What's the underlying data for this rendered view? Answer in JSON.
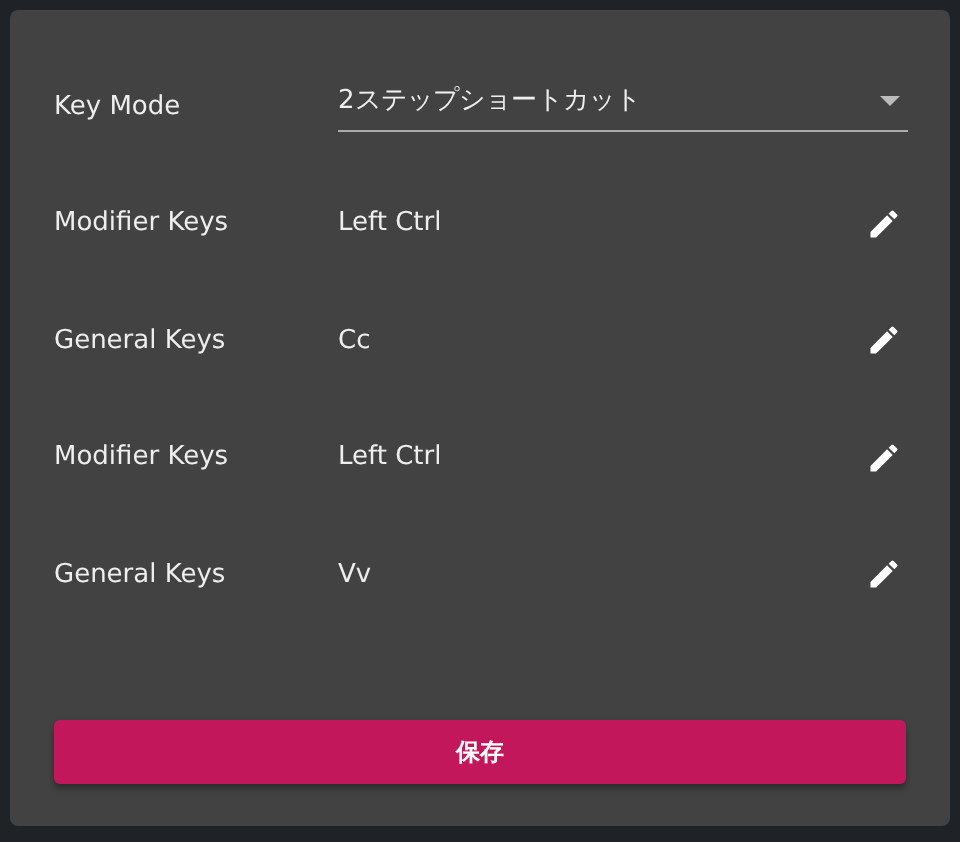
{
  "rows": [
    {
      "kind": "select",
      "label": "Key Mode",
      "value": "2ステップショートカット"
    },
    {
      "kind": "key",
      "label": "Modifier Keys",
      "value": "Left Ctrl"
    },
    {
      "kind": "key",
      "label": "General Keys",
      "value": "Cc"
    },
    {
      "kind": "key",
      "label": "Modifier Keys",
      "value": "Left Ctrl"
    },
    {
      "kind": "key",
      "label": "General Keys",
      "value": "Vv"
    }
  ],
  "save_button": "保存"
}
